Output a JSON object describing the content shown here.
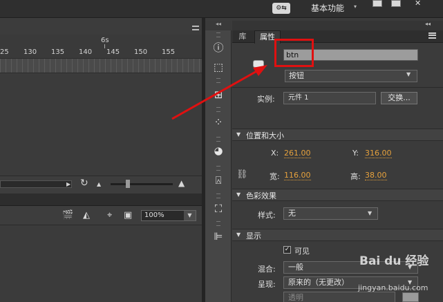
{
  "top_bar": {
    "sync_icon": "sync-settings-icon",
    "workspace_label": "基本功能",
    "workspace_caret": "▾"
  },
  "timeline": {
    "seconds_marker": "6s",
    "frame_ticks": [
      "25",
      "130",
      "135",
      "140",
      "145",
      "150",
      "155"
    ],
    "scroll_arrow": "▶",
    "loop_icon": "↻",
    "zoom_small_icon": "▲",
    "zoom_large_icon": "▲"
  },
  "stage": {
    "zoom_value": "100%",
    "zoom_arrow": "▼",
    "tools": [
      "clapper-icon",
      "transform-icon",
      "snap-center-icon",
      "clip-icon"
    ]
  },
  "panel": {
    "collapse_arrows": "◂◂",
    "tabs": {
      "library": "库",
      "properties": "属性"
    },
    "instance_name": "btn",
    "symbol_type": "按钮",
    "instance_label": "实例:",
    "instance_value": "元件 1",
    "swap_label": "交换...",
    "position_section": "位置和大小",
    "x_label": "X:",
    "x_value": "261.00",
    "y_label": "Y:",
    "y_value": "316.00",
    "width_label": "宽:",
    "width_value": "116.00",
    "height_label": "高:",
    "height_value": "38.00",
    "color_section": "色彩效果",
    "style_label": "样式:",
    "style_value": "无",
    "display_section": "显示",
    "visible_label": "可见",
    "visible_checked": "✓",
    "blend_label": "混合:",
    "blend_value": "一般",
    "render_label": "呈现:",
    "render_value": "原来的（无更改）",
    "transparent_value": "透明",
    "arrow": "▼",
    "caret": "▼"
  },
  "icon_column": [
    "info-icon",
    "transform-box-icon",
    "align-icon",
    "color-swatches-icon",
    "palette-icon",
    "stamp-icon",
    "components-icon",
    "align-left-icon"
  ],
  "watermark": {
    "text": "Bai du 经验",
    "url": "jingyan.baidu.com"
  },
  "colors": {
    "highlight": "#e01010",
    "value_orange": "#e7a23c",
    "panel_bg": "#3b3b3b"
  }
}
